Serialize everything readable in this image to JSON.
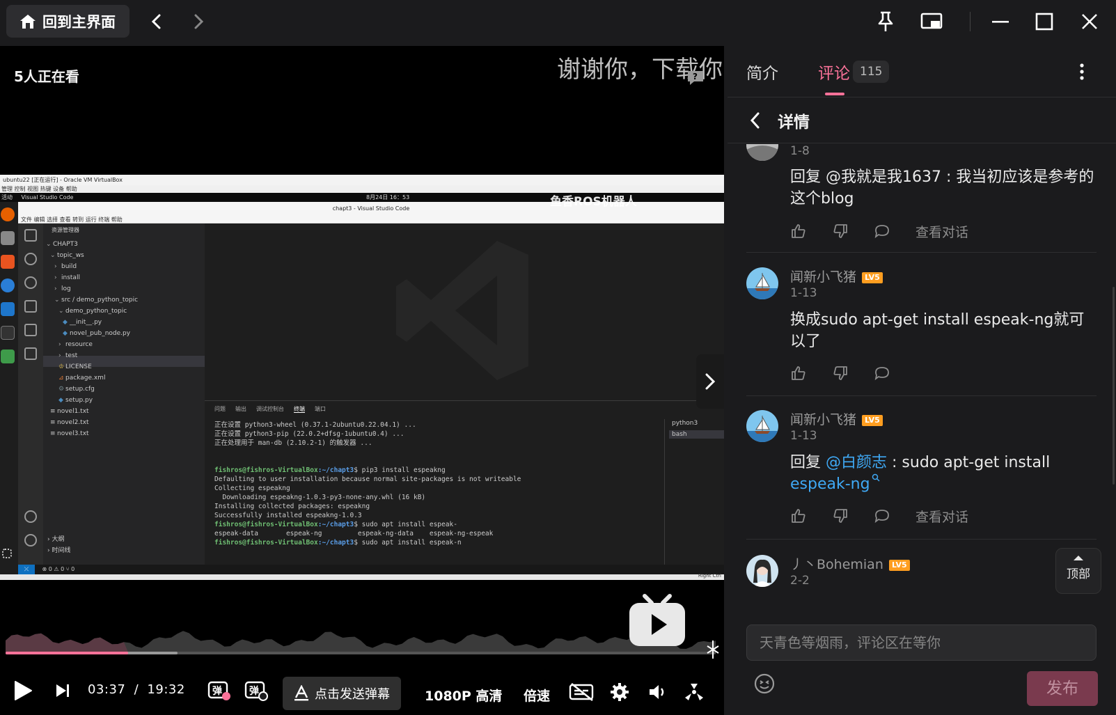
{
  "titlebar": {
    "home_label": "回到主界面",
    "icons": [
      "home-icon",
      "back-arrow-icon",
      "forward-arrow-icon",
      "pin-icon",
      "mini-window-icon",
      "minimize-icon",
      "maximize-icon",
      "close-icon"
    ]
  },
  "video": {
    "viewers": "5人正在看",
    "danmaku_text": "谢谢你，下载你",
    "overlay_watermark": "鱼香ROS机器人",
    "screen": {
      "vm_title": "ubuntu22 [正在运行] - Oracle VM VirtualBox",
      "vm_menu": "管理  控制  视图  热键  设备  帮助",
      "gnome_activities": "活动",
      "gnome_app": "Visual Studio Code",
      "gnome_clock": "8月24日  16：53",
      "vscode_title": "chapt3 - Visual Studio Code",
      "vscode_menu": "文件  编辑  选择  查看  转到  运行  终端  帮助",
      "explorer_header": "资源管理器",
      "tree": [
        {
          "label": "CHAPT3",
          "indent": 0,
          "arrow": "v"
        },
        {
          "label": "topic_ws",
          "indent": 1,
          "arrow": "v"
        },
        {
          "label": "build",
          "indent": 2,
          "arrow": ">"
        },
        {
          "label": "install",
          "indent": 2,
          "arrow": ">"
        },
        {
          "label": "log",
          "indent": 2,
          "arrow": ">"
        },
        {
          "label": "src / demo_python_topic",
          "indent": 2,
          "arrow": "v"
        },
        {
          "label": "demo_python_topic",
          "indent": 3,
          "arrow": "v"
        },
        {
          "label": "__init__.py",
          "indent": 4,
          "arrow": ""
        },
        {
          "label": "novel_pub_node.py",
          "indent": 4,
          "arrow": ""
        },
        {
          "label": "resource",
          "indent": 3,
          "arrow": ">"
        },
        {
          "label": "test",
          "indent": 3,
          "arrow": ">"
        },
        {
          "label": "LICENSE",
          "indent": 3,
          "arrow": ""
        },
        {
          "label": "package.xml",
          "indent": 3,
          "arrow": ""
        },
        {
          "label": "setup.cfg",
          "indent": 3,
          "arrow": ""
        },
        {
          "label": "setup.py",
          "indent": 3,
          "arrow": ""
        },
        {
          "label": "novel1.txt",
          "indent": 1,
          "arrow": ""
        },
        {
          "label": "novel2.txt",
          "indent": 1,
          "arrow": ""
        },
        {
          "label": "novel3.txt",
          "indent": 1,
          "arrow": ""
        }
      ],
      "outline_label": "大纲",
      "timeline_label": "时间线",
      "panel_tabs": [
        "问题",
        "输出",
        "调试控制台",
        "终端",
        "端口"
      ],
      "terminal_lines": [
        "正在设置 python3-wheel (0.37.1-2ubuntu0.22.04.1) ...",
        "正在设置 python3-pip (22.0.2+dfsg-1ubuntu0.4) ...",
        "正在处理用于 man-db (2.10.2-1) 的触发器 ...",
        "",
        "",
        "__PROMPT__pip3 install espeakng",
        "Defaulting to user installation because normal site-packages is not writeable",
        "Collecting espeakng",
        "  Downloading espeakng-1.0.3-py3-none-any.whl (16 kB)",
        "Installing collected packages: espeakng",
        "Successfully installed espeakng-1.0.3",
        "__PROMPT__sudo apt install espeak-",
        "espeak-data       espeak-ng         espeak-ng-data    espeak-ng-espeak",
        "__PROMPT__sudo apt install espeak-n"
      ],
      "prompt_user": "fishros@fishros-VirtualBox",
      "prompt_path": ":~/chapt3",
      "terminal_sessions": [
        "python3",
        "bash"
      ],
      "status_left": "⊗ 0 ⚠ 0   ⑂ 0",
      "vm_status": "Right Ctrl"
    },
    "progress": 0.173,
    "buffered": 0.242
  },
  "controls": {
    "current_time": "03:37",
    "separator": "/",
    "duration": "19:32",
    "send_danmaku": "点击发送弹幕",
    "quality": "1080P 高清",
    "speed": "倍速"
  },
  "sidebar": {
    "tab_intro": "简介",
    "tab_comments": "评论",
    "comment_count": "115",
    "detail_title": "详情",
    "comments": [
      {
        "date": "1-8",
        "text_prefix": "回复 ",
        "mention": "",
        "text": "回复 @我就是我1637 : 我当初应该是参考的这个blog",
        "show_view_conv": true
      },
      {
        "name": "闻新小飞猪",
        "level": "LV5",
        "date": "1-13",
        "text": "换成sudo apt-get install espeak-ng就可以了",
        "show_view_conv": false
      },
      {
        "name": "闻新小飞猪",
        "level": "LV5",
        "date": "1-13",
        "text_prefix": "回复 ",
        "mention": "@白颜志",
        "text_suffix": " : sudo apt-get install ",
        "link": "espeak-ng",
        "show_view_conv": true
      },
      {
        "name": "丿丶Bohemian",
        "level": "LV5",
        "date": "2-2"
      }
    ],
    "view_conversation": "查看对话",
    "top_button": "顶部",
    "input_placeholder": "天青色等烟雨，评论区在等你",
    "publish": "发布"
  },
  "colors": {
    "accent": "#fb7299",
    "mention": "#3fa9f5",
    "level_badge": "#ff9e20"
  }
}
